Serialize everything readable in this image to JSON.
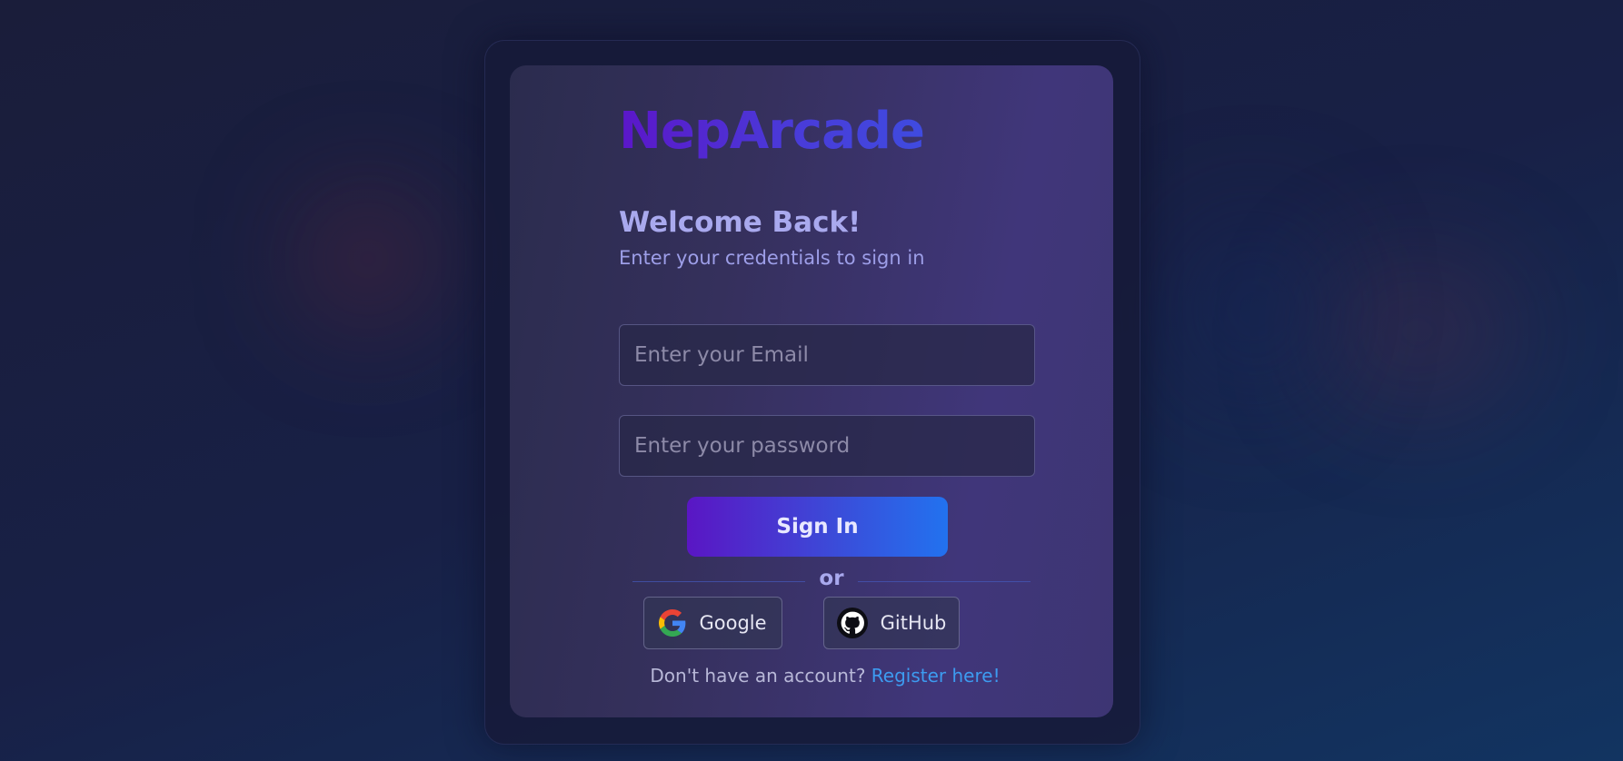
{
  "brand": {
    "name": "NepArcade"
  },
  "heading": {
    "title": "Welcome Back!",
    "subtitle": "Enter your credentials to sign in"
  },
  "form": {
    "email_placeholder": "Enter your Email",
    "password_placeholder": "Enter your password",
    "submit_label": "Sign In"
  },
  "divider": {
    "label": "or"
  },
  "social": {
    "google_label": "Google",
    "github_label": "GitHub",
    "google_icon": "google-icon",
    "github_icon": "github-icon"
  },
  "footer": {
    "prompt": "Don't have an account?",
    "link_label": "Register here!"
  },
  "colors": {
    "background": "#1a1d3a",
    "card": "#3a3370",
    "accent_purple": "#5a16c4",
    "accent_blue": "#2272ef",
    "link": "#3d9bf0"
  }
}
